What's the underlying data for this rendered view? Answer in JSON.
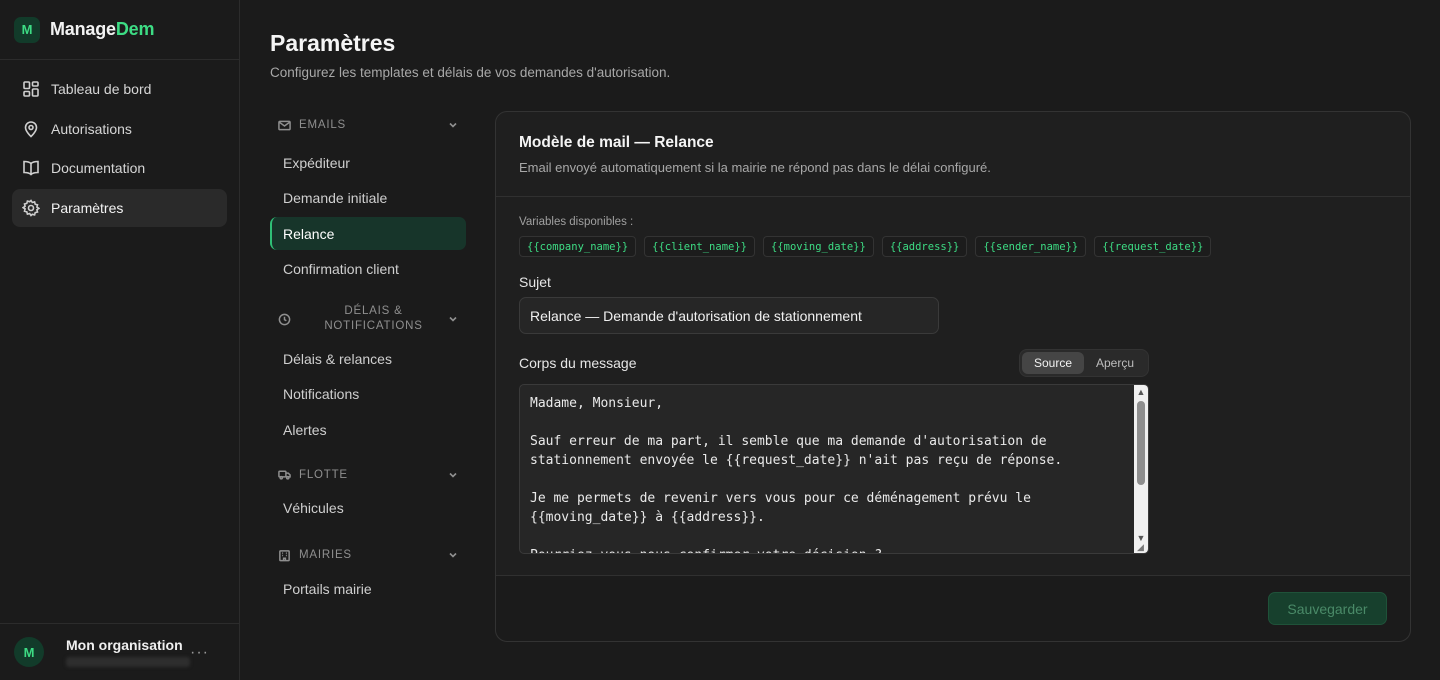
{
  "app": {
    "logo_letter": "M",
    "name_part1": "Manage",
    "name_part2": "Dem",
    "accent_color": "#3ddc84"
  },
  "sidebar": {
    "items": [
      {
        "label": "Tableau de bord",
        "icon": "dashboard-icon"
      },
      {
        "label": "Autorisations",
        "icon": "map-pin-icon"
      },
      {
        "label": "Documentation",
        "icon": "book-icon"
      },
      {
        "label": "Paramètres",
        "icon": "gear-icon",
        "active": true
      }
    ],
    "org": {
      "avatar_letter": "M",
      "name": "Mon organisation",
      "more": "···"
    }
  },
  "page": {
    "title": "Paramètres",
    "subtitle": "Configurez les templates et délais de vos demandes d'autorisation."
  },
  "subnav": {
    "emails": {
      "title": "EMAILS",
      "icon": "mail-icon",
      "items": [
        "Expéditeur",
        "Demande initiale",
        "Relance",
        "Confirmation client"
      ]
    },
    "delais": {
      "title_line1": "DÉLAIS &",
      "title_line2": "NOTIFICATIONS",
      "icon": "clock-icon",
      "items": [
        "Délais & relances",
        "Notifications",
        "Alertes"
      ]
    },
    "flotte": {
      "title": "FLOTTE",
      "icon": "truck-icon",
      "items": [
        "Véhicules"
      ]
    },
    "mairies": {
      "title": "MAIRIES",
      "icon": "building-icon",
      "items": [
        "Portails mairie"
      ]
    },
    "active_item": "Relance"
  },
  "card": {
    "title": "Modèle de mail — Relance",
    "description": "Email envoyé automatiquement si la mairie ne répond pas dans le délai configuré.",
    "variables_label": "Variables disponibles :",
    "variables": [
      "{{company_name}}",
      "{{client_name}}",
      "{{moving_date}}",
      "{{address}}",
      "{{sender_name}}",
      "{{request_date}}"
    ],
    "subject_label": "Sujet",
    "subject_value": "Relance — Demande d'autorisation de stationnement",
    "body_label": "Corps du message",
    "mode_source": "Source",
    "mode_preview": "Aperçu",
    "body_value": "Madame, Monsieur,\n\nSauf erreur de ma part, il semble que ma demande d'autorisation de stationnement envoyée le {{request_date}} n'ait pas reçu de réponse.\n\nJe me permets de revenir vers vous pour ce déménagement prévu le {{moving_date}} à {{address}}.\n\nPourriez-vous nous confirmer votre décision ?",
    "save_label": "Sauvegarder"
  }
}
